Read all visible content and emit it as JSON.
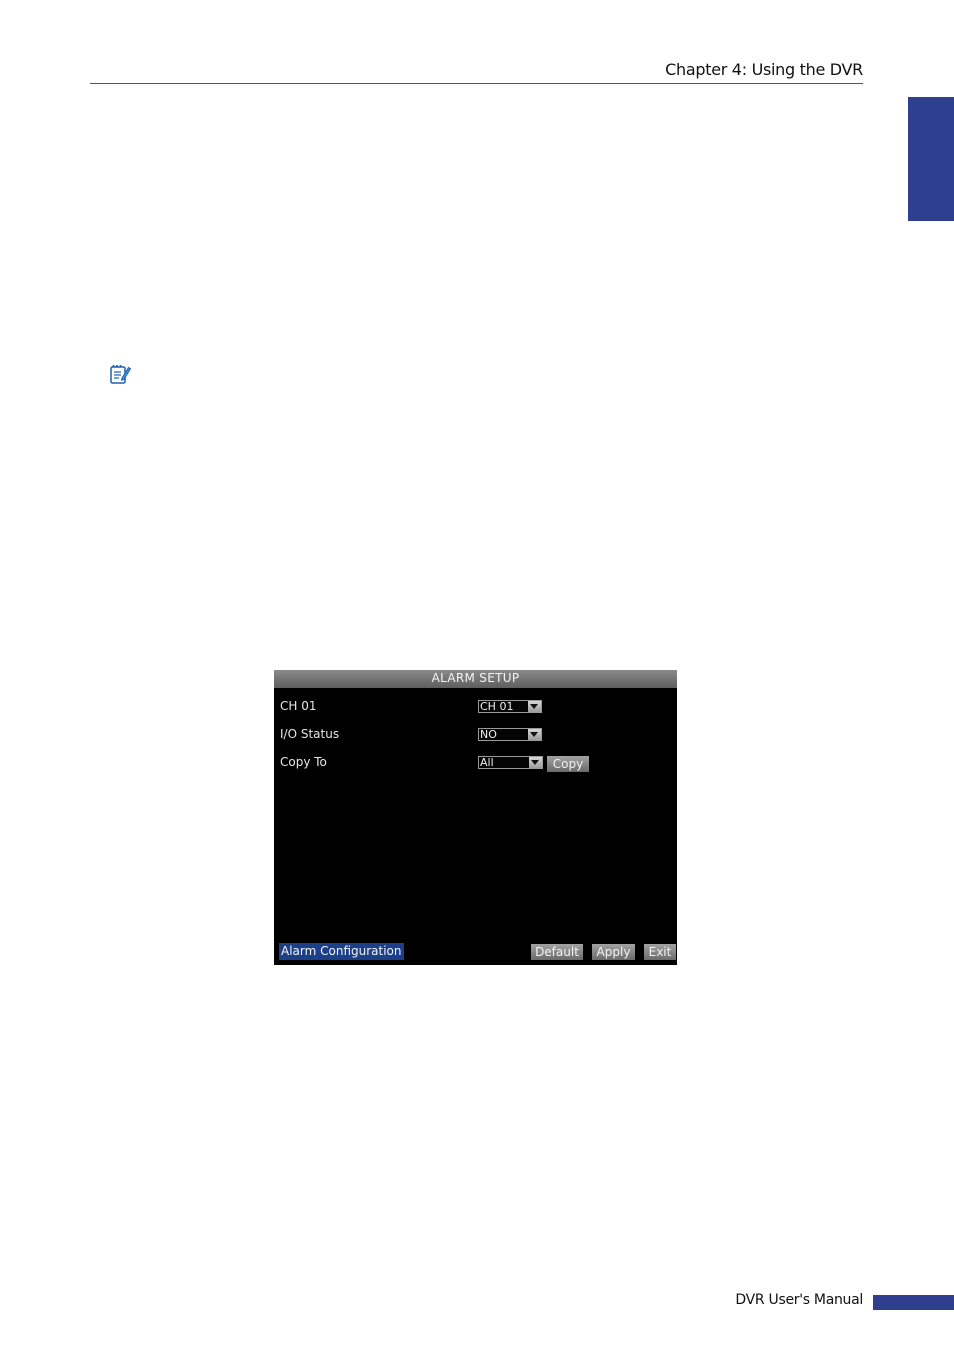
{
  "header": {
    "chapter_title": "Chapter 4: Using the DVR"
  },
  "note_icon": "note-pencil-icon",
  "dvr_dialog": {
    "title": "ALARM SETUP",
    "rows": [
      {
        "label": "CH 01",
        "value": "CH 01"
      },
      {
        "label": "I/O Status",
        "value": "NO"
      },
      {
        "label": "Copy To",
        "value": "All"
      }
    ],
    "copy_button": "Copy",
    "active_tab": "Alarm Configuration",
    "buttons": {
      "default": "Default",
      "apply": "Apply",
      "exit": "Exit"
    }
  },
  "footer": {
    "manual_title": "DVR User's Manual"
  },
  "colors": {
    "accent_blue": "#2d3f8e",
    "dialog_background": "#000000",
    "title_bar_gray": "#6e6e6e",
    "active_tab_blue": "#1c3f8a"
  }
}
